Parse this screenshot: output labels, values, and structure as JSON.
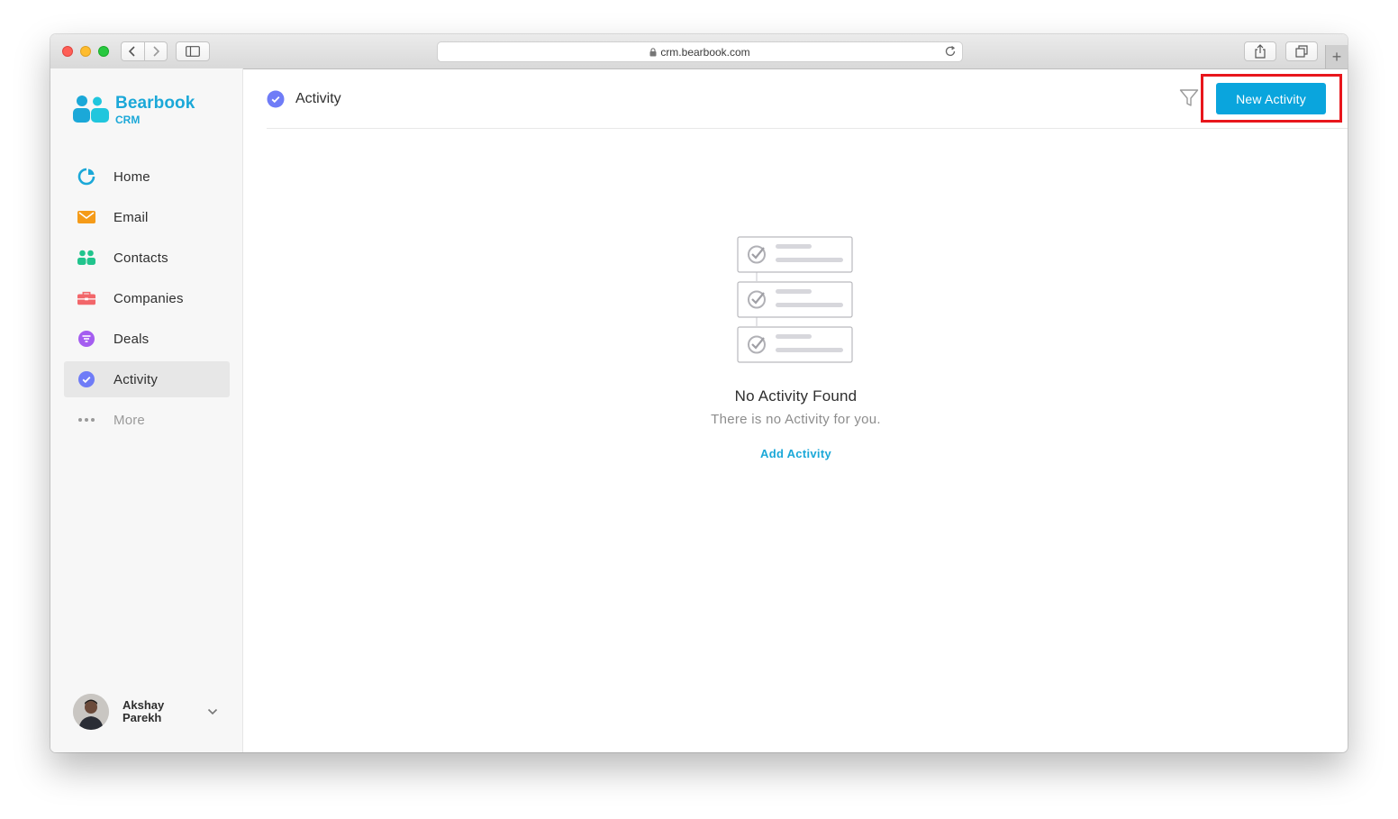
{
  "browser": {
    "url": "crm.bearbook.com"
  },
  "brand": {
    "name": "Bearbook",
    "sub": "CRM",
    "color": "#1ba8d8"
  },
  "sidebar": {
    "items": [
      {
        "label": "Home",
        "icon": "pie-chart-icon",
        "color": "#1ba8d8",
        "active": false
      },
      {
        "label": "Email",
        "icon": "envelope-icon",
        "color": "#f59b19",
        "active": false
      },
      {
        "label": "Contacts",
        "icon": "people-icon",
        "color": "#21c48d",
        "active": false
      },
      {
        "label": "Companies",
        "icon": "briefcase-icon",
        "color": "#f2666a",
        "active": false
      },
      {
        "label": "Deals",
        "icon": "filter-circle-icon",
        "color": "#a45df0",
        "active": false
      },
      {
        "label": "Activity",
        "icon": "check-circle-icon",
        "color": "#6f7cf7",
        "active": true
      },
      {
        "label": "More",
        "icon": "ellipsis-icon",
        "color": "#9a9a9a",
        "active": false
      }
    ]
  },
  "user": {
    "name": "Akshay Parekh"
  },
  "header": {
    "title": "Activity",
    "new_button": "New Activity",
    "accent": "#0aa5dd",
    "highlight_color": "#e8161c"
  },
  "empty_state": {
    "title": "No Activity Found",
    "subtitle": "There is no Activity for you.",
    "link": "Add Activity"
  }
}
